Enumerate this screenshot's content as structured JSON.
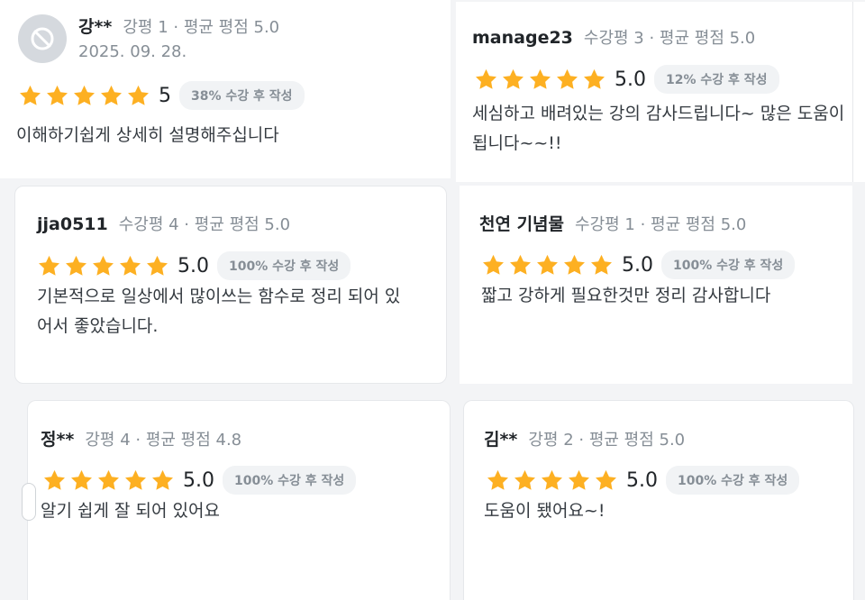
{
  "reviews": [
    {
      "name": "강**",
      "meta": "강평 1 · 평균 평점 5.0",
      "date": "2025. 09. 28.",
      "score": "5",
      "badge": "38% 수강 후 작성",
      "stars": 5,
      "body_lines": [
        "이해하기쉽게 상세히 설명해주십니다"
      ]
    },
    {
      "name": "manage23",
      "meta": "수강평 3 · 평균 평점 5.0",
      "score": "5.0",
      "badge": "12% 수강 후 작성",
      "stars": 5,
      "body_lines": [
        "세심하고 배려있는 강의 감사드립니다~ 많은 도움이",
        "됩니다~~!!"
      ]
    },
    {
      "name": "jja0511",
      "meta": "수강평 4 · 평균 평점 5.0",
      "score": "5.0",
      "badge": "100% 수강 후 작성",
      "stars": 5,
      "body_lines": [
        "기본적으로 일상에서 많이쓰는 함수로 정리 되어 있",
        "어서 좋았습니다."
      ]
    },
    {
      "name": "천연 기념물",
      "meta": "수강평 1 · 평균 평점 5.0",
      "score": "5.0",
      "badge": "100% 수강 후 작성",
      "stars": 5,
      "body_lines": [
        "짧고 강하게 필요한것만 정리 감사합니다"
      ]
    },
    {
      "name": "정**",
      "meta": "강평 4 · 평균 평점 4.8",
      "score": "5.0",
      "badge": "100% 수강 후 작성",
      "stars": 5,
      "body_lines": [
        "알기 쉽게 잘 되어 있어요"
      ]
    },
    {
      "name": "김**",
      "meta": "강평 2 · 평균 평점 5.0",
      "score": "5.0",
      "badge": "100% 수강 후 작성",
      "stars": 5,
      "body_lines": [
        "도움이 됐어요~!"
      ]
    }
  ],
  "colors": {
    "star": "#fdb022",
    "muted": "#868e96",
    "badge_bg": "#f1f3f5"
  },
  "icons": {
    "star": "star-icon",
    "avatar": "default-avatar-icon"
  }
}
